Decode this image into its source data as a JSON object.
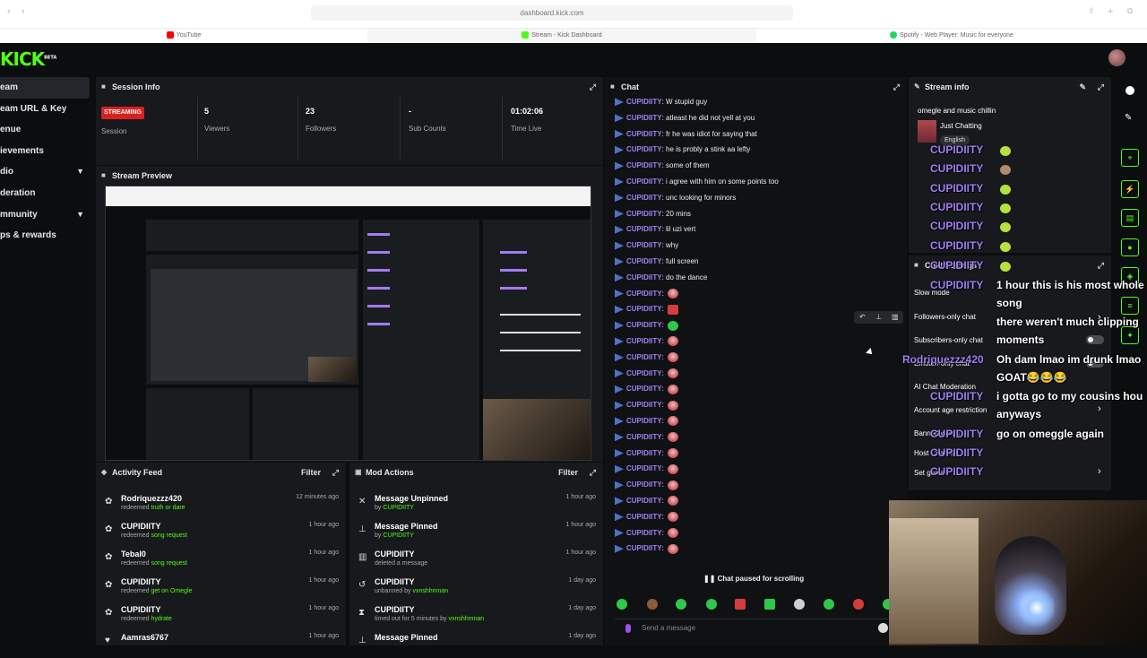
{
  "browser": {
    "url": "dashboard.kick.com",
    "tabs": [
      {
        "label": "YouTube",
        "icon_color": "#ff0000"
      },
      {
        "label": "Stream - Kick Dashboard",
        "icon_color": "#53fc18"
      },
      {
        "label": "Spotify - Web Player: Music for everyone",
        "icon_color": "#1ed760"
      }
    ]
  },
  "brand": {
    "logo": "KICK",
    "beta": "BETA",
    "accent": "#53fc18"
  },
  "sidebar": {
    "items": [
      {
        "label": "eam"
      },
      {
        "label": "eam URL & Key"
      },
      {
        "label": "enue"
      },
      {
        "label": "ievements"
      },
      {
        "label": "dio"
      },
      {
        "label": "deration"
      },
      {
        "label": "mmunity"
      },
      {
        "label": "ps & rewards"
      }
    ]
  },
  "session": {
    "title": "Session Info",
    "status": "STREAMING",
    "session_label": "Session",
    "viewers": "5",
    "viewers_label": "Viewers",
    "followers": "23",
    "followers_label": "Followers",
    "subs": "-",
    "subs_label": "Sub Counts",
    "time": "01:02:06",
    "time_label": "Time Live"
  },
  "preview": {
    "title": "Stream Preview"
  },
  "activity": {
    "title": "Activity Feed",
    "filter": "Filter",
    "items": [
      {
        "name": "Rodriquezzz420",
        "action": "redeemed",
        "reward": "truth or dare",
        "time": "12 minutes ago"
      },
      {
        "name": "CUPIDIITY",
        "action": "redeemed",
        "reward": "song request",
        "time": "1 hour ago"
      },
      {
        "name": "Tebal0",
        "action": "redeemed",
        "reward": "song request",
        "time": "1 hour ago"
      },
      {
        "name": "CUPIDIITY",
        "action": "redeemed",
        "reward": "get on Omegle",
        "time": "1 hour ago"
      },
      {
        "name": "CUPIDIITY",
        "action": "redeemed",
        "reward": "hydrate",
        "time": "1 hour ago"
      },
      {
        "name": "Aamras6767",
        "action": "",
        "reward": "",
        "time": "1 hour ago"
      }
    ]
  },
  "mod": {
    "title": "Mod Actions",
    "filter": "Filter",
    "items": [
      {
        "title": "Message Unpinned",
        "sub": "by",
        "who": "CUPIDIITY",
        "time": "1 hour ago",
        "icon": "pin-off-icon"
      },
      {
        "title": "Message Pinned",
        "sub": "by",
        "who": "CUPIDIITY",
        "time": "1 hour ago",
        "icon": "pin-icon"
      },
      {
        "title": "CUPIDIITY",
        "sub": "deleted a message",
        "who": "",
        "time": "1 hour ago",
        "icon": "trash-icon"
      },
      {
        "title": "CUPIDIITY",
        "sub": "unbanned by",
        "who": "vxnshhmnan",
        "time": "1 day ago",
        "icon": "undo-icon"
      },
      {
        "title": "CUPIDIITY",
        "sub": "timed out for 5 minutes by",
        "who": "vxnshhmnan",
        "time": "1 day ago",
        "icon": "hourglass-icon"
      },
      {
        "title": "Message Pinned",
        "sub": "",
        "who": "",
        "time": "1 day ago",
        "icon": "pin-icon"
      }
    ]
  },
  "chat": {
    "title": "Chat",
    "username": "CUPIDIITY",
    "messages": [
      {
        "text": "W stupid guy"
      },
      {
        "text": "atleast he did not yell at you"
      },
      {
        "text": "fr he was idiot for saying that"
      },
      {
        "text": "he is probly a stink aa lefty"
      },
      {
        "text": "some of them"
      },
      {
        "text": "i agree with him on some points too"
      },
      {
        "text": "unc looking for minors"
      },
      {
        "text": "20 mins"
      },
      {
        "text": "lil uzi vert"
      },
      {
        "text": "why"
      },
      {
        "text": "full screen"
      },
      {
        "text": "do the dance"
      }
    ],
    "emote_rows": 18,
    "paused": "Chat paused for scrolling",
    "send_placeholder": "Send a message"
  },
  "stream_info": {
    "title": "Stream info",
    "stream_title": "omegle and music chillin",
    "category": "Just Chatting",
    "language": "English"
  },
  "chat_settings": {
    "title": "Chat Settings",
    "items": [
      {
        "label": "Slow mode"
      },
      {
        "label": "Followers-only chat"
      },
      {
        "label": "Subscribers-only chat"
      },
      {
        "label": "Emotes-only chat"
      },
      {
        "label": "AI Chat Moderation"
      },
      {
        "label": "Account age restriction"
      },
      {
        "label": "Banned words"
      },
      {
        "label": "Host Channel"
      },
      {
        "label": "Set goals"
      }
    ]
  },
  "overlay": {
    "names": [
      "CUPIDIITY",
      "CUPIDIITY",
      "CUPIDIITY",
      "CUPIDIITY",
      "CUPIDIITY",
      "CUPIDIITY",
      "CUPIDIITY",
      "CUPIDIITY"
    ],
    "msg1_name": "CUPIDIITY",
    "msg1": "1 hour this is his most whole",
    "msg1b": "song",
    "msg2": "there weren't much clipping",
    "msg2b": "moments",
    "msg3_name": "Rodriquezzz420",
    "msg3": "Oh dam lmao im drunk lmao",
    "msg3b": "GOAT😂😂😂",
    "msg4_name": "CUPIDIITY",
    "msg4": "i gotta go to my cousins hou",
    "msg4b": "anyways",
    "msg5_name": "CUPIDIITY",
    "msg5": "go on omeggle again",
    "tail_names": [
      "CUPIDIITY",
      "CUPIDIITY"
    ]
  }
}
